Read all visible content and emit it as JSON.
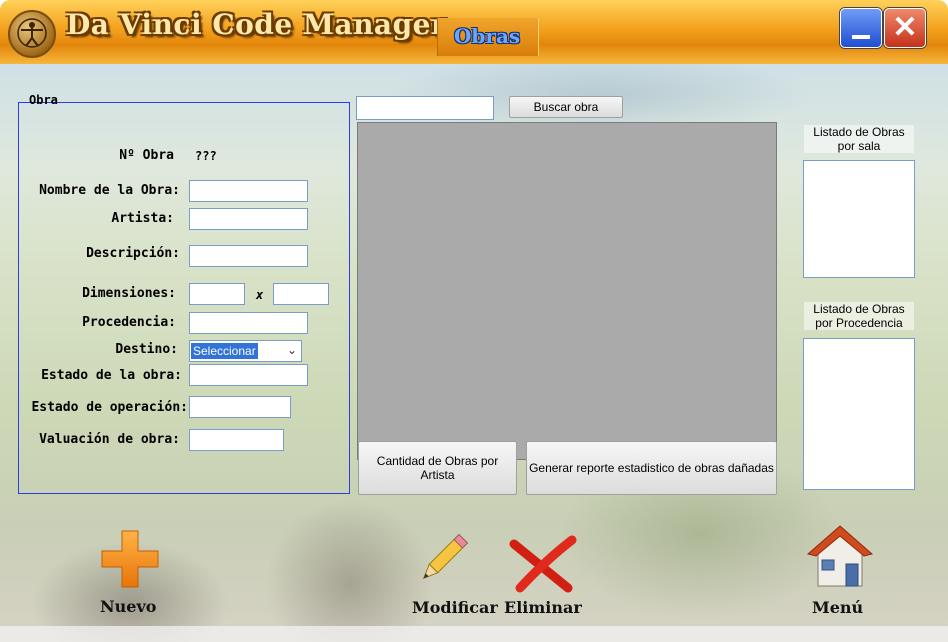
{
  "window": {
    "app_title": "Da Vinci Code Manager",
    "section_tab": "Obras",
    "minimize_icon": "minimize-icon",
    "close_icon": "close-icon",
    "close_glyph": "✕"
  },
  "form": {
    "group_label": "Obra",
    "numero_label": "Nº Obra",
    "numero_value": "???",
    "nombre_label": "Nombre de la Obra:",
    "artista_label": "Artista:",
    "descripcion_label": "Descripción:",
    "dimensiones_label": "Dimensiones:",
    "dimensiones_separator": "x",
    "procedencia_label": "Procedencia:",
    "destino_label": "Destino:",
    "destino_selected": "Seleccionar",
    "estado_obra_label": "Estado de la obra:",
    "estado_operacion_label": "Estado de operación:",
    "valuacion_label": "Valuación de obra:"
  },
  "search": {
    "button_label": "Buscar obra"
  },
  "reports": {
    "cantidad_button": "Cantidad de Obras por Artista",
    "reporte_button": "Generar reporte estadistico de obras dañadas"
  },
  "side_lists": {
    "por_sala_label": "Listado de Obras por sala",
    "por_procedencia_label": "Listado de Obras por Procedencia"
  },
  "actions": {
    "nuevo": "Nuevo",
    "modificar": "Modificar",
    "eliminar": "Eliminar",
    "menu": "Menú"
  },
  "colors": {
    "title_orange": "#f3a21e",
    "group_border": "#2a3fe0",
    "grid_gray": "#aaaaaa",
    "select_highlight": "#3173d6"
  }
}
